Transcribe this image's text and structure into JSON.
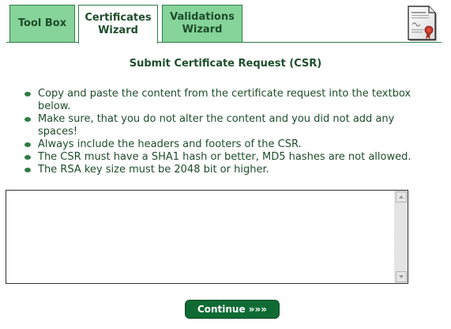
{
  "tabs": {
    "toolbox": "Tool Box",
    "certificates": "Certificates\nWizard",
    "validations": "Validations\nWizard",
    "active": "certificates"
  },
  "icon": {
    "name": "certificate-document-icon",
    "seal_color": "#c0392b"
  },
  "title": "Submit Certificate Request (CSR)",
  "instructions": [
    "Copy and paste the content from the certificate request into the textbox below.",
    "Make sure, that you do not alter the content and you did not add any spaces!",
    "Always include the headers and footers of the CSR.",
    "The CSR must have a SHA1 hash or better, MD5 hashes are not allowed.",
    "The RSA key size must be 2048 bit or higher."
  ],
  "csr_input": {
    "value": ""
  },
  "continue_button": {
    "label": "Continue »»»"
  },
  "colors": {
    "tab_fill": "#86d49a",
    "active_tab_fill": "#ffffff",
    "border_green": "#2e7d45",
    "text_green": "#1e4d2b",
    "button_fill": "#0f6b33"
  }
}
